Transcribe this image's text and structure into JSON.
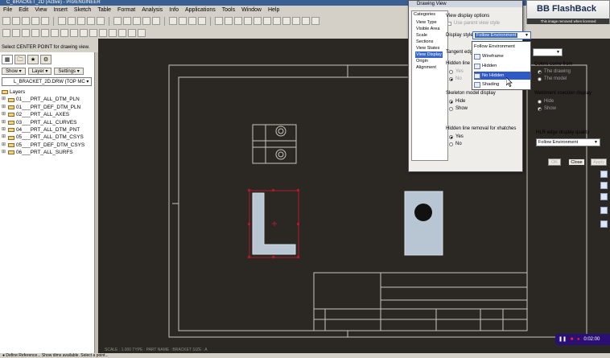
{
  "window": {
    "title": "C_BRACKET_2D (Active) - Pro/ENGINEER"
  },
  "menu": [
    "File",
    "Edit",
    "View",
    "Insert",
    "Sketch",
    "Table",
    "Format",
    "Analysis",
    "Info",
    "Applications",
    "Tools",
    "Window",
    "Help"
  ],
  "status_prompt": "Select CENTER POINT for drawing view.",
  "left_panel": {
    "buttons": {
      "show": "Show ▾",
      "layer": "Layer ▾",
      "settings": "Settings ▾"
    },
    "drawing_selector": "L_BRACKET_2D.DRW (TOP MC ▾",
    "tree_header": "Layers",
    "layers": [
      "01___PRT_ALL_DTM_PLN",
      "01___PRT_DEF_DTM_PLN",
      "02___PRT_ALL_AXES",
      "03___PRT_ALL_CURVES",
      "04___PRT_ALL_DTM_PNT",
      "05___PRT_ALL_DTM_CSYS",
      "05___PRT_DEF_DTM_CSYS",
      "06___PRT_ALL_SURFS"
    ]
  },
  "canvas": {
    "bottom_info": "SCALE : 1.000    TYPE : PART    NAME : BRACKET    SIZE : A"
  },
  "bottom_bar": "●  Define Reference... Show dims available. Select a point...",
  "dialog": {
    "title": "Drawing View",
    "categories_label": "Categories",
    "categories": [
      "View Type",
      "Visible Area",
      "Scale",
      "Sections",
      "View States",
      "View Display",
      "Origin",
      "Alignment"
    ],
    "selected_category": "View Display",
    "section_title": "View display options",
    "use_parent_style": "Use parent view style",
    "display_style_label": "Display style",
    "display_style_value": "Follow Environment",
    "tangent_edges_label": "Tangent edge",
    "hidden_line_label": "Hidden line r",
    "yes": "Yes",
    "no": "No",
    "colors_come_from_label": "Colors come from",
    "colors_opt1": "The drawing",
    "colors_opt2": "The model",
    "skeleton_label": "Skeleton model display",
    "hide": "Hide",
    "show": "Show",
    "weldment_label": "Weldment xsection display",
    "hidden_removal_label": "Hidden line removal for xhatches",
    "hlr_quality_label": "HLR edge display quality",
    "hlr_quality_value": "Follow Environment",
    "ok": "OK",
    "close": "Close",
    "apply": "Apply"
  },
  "display_style_dropdown": {
    "options": [
      "Follow Environment",
      "Wireframe",
      "Hidden",
      "No Hidden",
      "Shading"
    ],
    "highlighted": "No Hidden"
  },
  "watermark": {
    "title": "BB FlashBack",
    "subtitle": "This image removed when licensed"
  },
  "recorder": {
    "time": "0:02:00"
  },
  "colors": {
    "canvas_bg": "#2b2824",
    "sheet_lines": "#c8c4bc",
    "part_fill": "#b7c6d2",
    "selection_red": "#b0192d",
    "highlight": "#2f59c7"
  }
}
